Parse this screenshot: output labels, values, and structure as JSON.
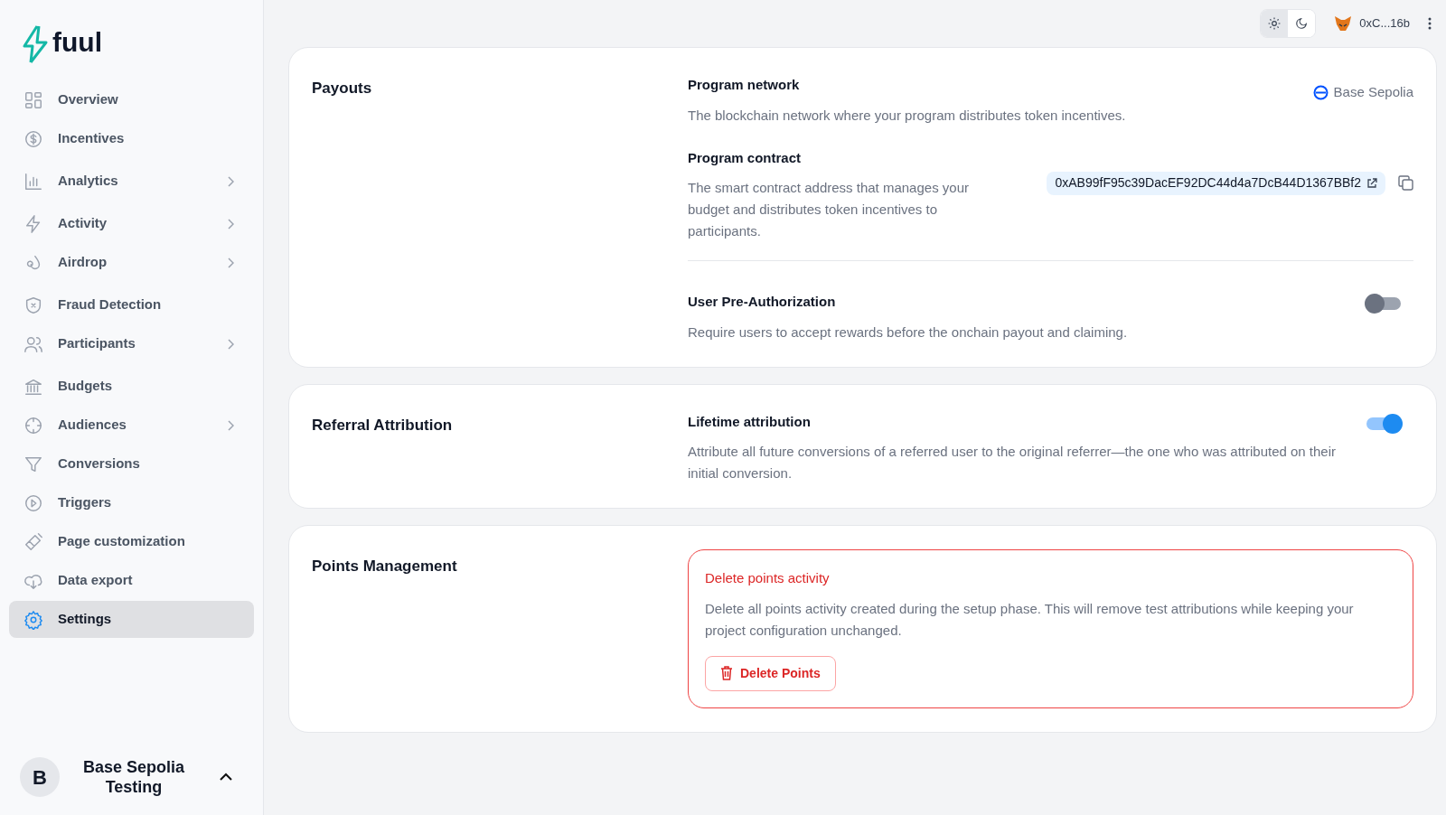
{
  "sidebar": {
    "logo": "fuul",
    "items": [
      {
        "label": "Overview",
        "has_submenu": false,
        "selected": false
      },
      {
        "label": "Incentives",
        "has_submenu": false,
        "selected": false
      },
      {
        "label": "Analytics",
        "has_submenu": true,
        "selected": false
      },
      {
        "label": "Activity",
        "has_submenu": true,
        "selected": false
      },
      {
        "label": "Airdrop",
        "has_submenu": true,
        "selected": false
      },
      {
        "label": "Fraud Detection",
        "has_submenu": false,
        "selected": false
      },
      {
        "label": "Participants",
        "has_submenu": true,
        "selected": false
      },
      {
        "label": "Budgets",
        "has_submenu": false,
        "selected": false
      },
      {
        "label": "Audiences",
        "has_submenu": true,
        "selected": false
      },
      {
        "label": "Conversions",
        "has_submenu": false,
        "selected": false
      },
      {
        "label": "Triggers",
        "has_submenu": false,
        "selected": false
      },
      {
        "label": "Page customization",
        "has_submenu": false,
        "selected": false
      },
      {
        "label": "Data export",
        "has_submenu": false,
        "selected": false
      },
      {
        "label": "Settings",
        "has_submenu": false,
        "selected": true
      }
    ],
    "project": {
      "initial": "B",
      "name": "Base Sepolia Testing",
      "expanded": true
    }
  },
  "topbar": {
    "theme_options": [
      {
        "kind": "light",
        "selected": true
      },
      {
        "kind": "dark",
        "selected": false
      }
    ],
    "wallet": "0xC...16b"
  },
  "sections": [
    {
      "title": "Payouts",
      "settings": [
        {
          "kind": "network",
          "title": "Program network",
          "description": "The blockchain network where your program distributes token incentives.",
          "value": "Base Sepolia"
        },
        {
          "kind": "contract",
          "title": "Program contract",
          "description": "The smart contract address that manages your budget and distributes token incentives to participants.",
          "value": "0xAB99fF95c39DacEF92DC44d4a7DcB44D1367BBf2"
        },
        {
          "kind": "toggle",
          "title": "User Pre-Authorization",
          "description": "Require users to accept rewards before the onchain payout and claiming.",
          "on": false
        }
      ]
    },
    {
      "title": "Referral Attribution",
      "settings": [
        {
          "kind": "toggle",
          "title": "Lifetime attribution",
          "description": "Attribute all future conversions of a referred user to the original referrer—the one who was attributed on their initial conversion.",
          "on": true
        }
      ]
    },
    {
      "title": "Points Management",
      "settings": [
        {
          "kind": "danger",
          "title": "Delete points activity",
          "description": "Delete all points activity created during the setup phase. This will remove test attributions while keeping your project configuration unchanged.",
          "button": "Delete Points"
        }
      ]
    }
  ]
}
